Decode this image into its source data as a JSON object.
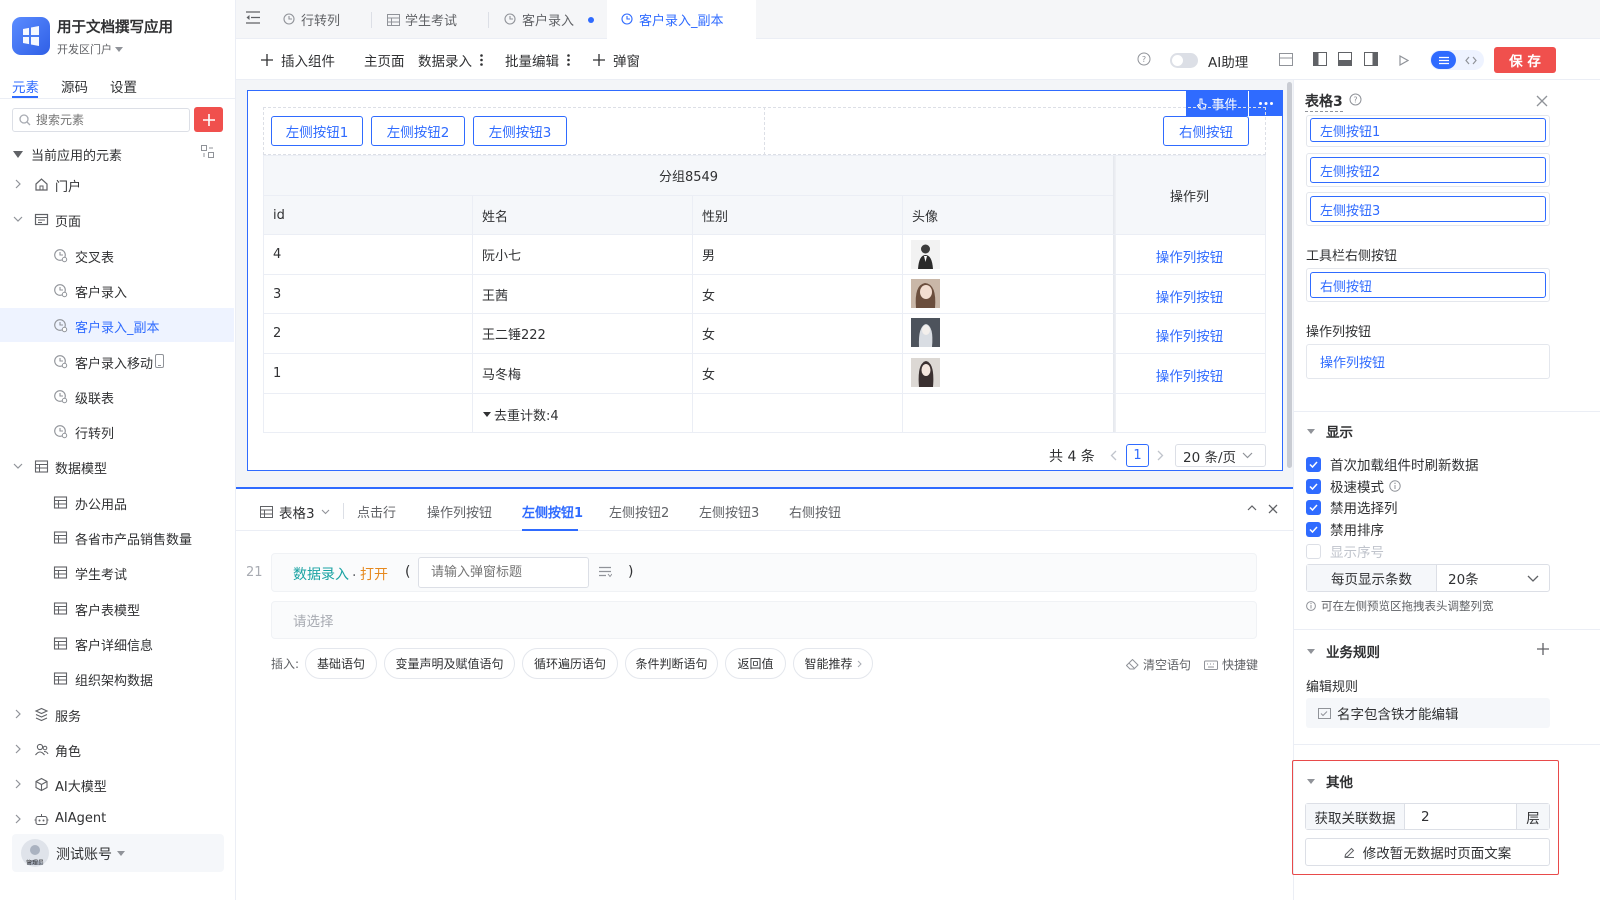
{
  "app": {
    "name": "用于文档撰写应用",
    "portal": "开发区门户"
  },
  "side_tabs": [
    "元素",
    "源码",
    "设置"
  ],
  "search": {
    "placeholder": "搜索元素"
  },
  "tree": {
    "section_label": "当前应用的元素",
    "items": [
      {
        "label": "门户",
        "icon": "home-icon",
        "level": 0,
        "collapsed": true
      },
      {
        "label": "页面",
        "icon": "page-icon",
        "level": 0,
        "collapsed": false
      },
      {
        "label": "交叉表",
        "icon": "form-page-icon",
        "level": 1
      },
      {
        "label": "客户录入",
        "icon": "form-page-icon",
        "level": 1
      },
      {
        "label": "客户录入_副本",
        "icon": "form-page-icon",
        "level": 1,
        "active": true
      },
      {
        "label": "客户录入移动",
        "icon": "form-page-icon",
        "level": 1,
        "mobile": true
      },
      {
        "label": "级联表",
        "icon": "form-page-icon",
        "level": 1
      },
      {
        "label": "行转列",
        "icon": "form-page-icon",
        "level": 1
      },
      {
        "label": "数据模型",
        "icon": "table-icon",
        "level": 0,
        "collapsed": false
      },
      {
        "label": "办公用品",
        "icon": "table-icon",
        "level": 1
      },
      {
        "label": "各省市产品销售数量",
        "icon": "table-icon",
        "level": 1
      },
      {
        "label": "学生考试",
        "icon": "table-icon",
        "level": 1
      },
      {
        "label": "客户表模型",
        "icon": "table-icon",
        "level": 1
      },
      {
        "label": "客户详细信息",
        "icon": "table-icon",
        "level": 1
      },
      {
        "label": "组织架构数据",
        "icon": "table-icon",
        "level": 1
      },
      {
        "label": "服务",
        "icon": "service-icon",
        "level": 0,
        "collapsed": true
      },
      {
        "label": "角色",
        "icon": "role-icon",
        "level": 0,
        "collapsed": true
      },
      {
        "label": "AI大模型",
        "icon": "model-icon",
        "level": 0,
        "collapsed": true
      },
      {
        "label": "AIAgent",
        "icon": "robot-icon",
        "level": 0,
        "collapsed": true
      }
    ]
  },
  "account": {
    "name": "测试账号",
    "badge": "管理员"
  },
  "tabs": [
    {
      "label": "行转列"
    },
    {
      "label": "学生考试"
    },
    {
      "label": "客户录入",
      "dirty": true
    },
    {
      "label": "客户录入_副本",
      "active": true
    }
  ],
  "toolbar": {
    "insert": "插入组件",
    "home": "主页面",
    "data_entry": "数据录入",
    "batch_edit": "批量编辑",
    "popup": "弹窗",
    "ai_assistant": "AI助理",
    "save": "保 存"
  },
  "canvas": {
    "event_label": "事件",
    "left_buttons": [
      "左侧按钮1",
      "左侧按钮2",
      "左侧按钮3"
    ],
    "right_button": "右侧按钮",
    "group_header": "分组8549",
    "op_header": "操作列",
    "columns": [
      "id",
      "姓名",
      "性别",
      "头像"
    ],
    "rows": [
      {
        "id": "4",
        "name": "阮小七",
        "gender": "男",
        "op": "操作列按钮"
      },
      {
        "id": "3",
        "name": "王茜",
        "gender": "女",
        "op": "操作列按钮"
      },
      {
        "id": "2",
        "name": "王二锤222",
        "gender": "女",
        "op": "操作列按钮"
      },
      {
        "id": "1",
        "name": "马冬梅",
        "gender": "女",
        "op": "操作列按钮"
      }
    ],
    "summary": "去重计数:4",
    "total": "共 4 条",
    "page": "1",
    "page_size": "20 条/页"
  },
  "bottom": {
    "tabs": [
      "表格3",
      "点击行",
      "操作列按钮",
      "左侧按钮1",
      "左侧按钮2",
      "左侧按钮3",
      "右侧按钮"
    ],
    "active_tab": "左侧按钮1",
    "line_no": "21",
    "code_obj": "数据录入",
    "code_method": "打开",
    "title_placeholder": "请输入弹窗标题",
    "select_placeholder": "请选择",
    "insert_label": "插入:",
    "chips": [
      "基础语句",
      "变量声明及赋值语句",
      "循环遍历语句",
      "条件判断语句",
      "返回值",
      "智能推荐"
    ],
    "clear": "清空语句",
    "shortcut": "快捷键"
  },
  "panel": {
    "title": "表格3",
    "left_buttons": [
      "左侧按钮1",
      "左侧按钮2",
      "左侧按钮3"
    ],
    "right_section": "工具栏右侧按钮",
    "right_button": "右侧按钮",
    "op_section": "操作列按钮",
    "op_button": "操作列按钮",
    "display_title": "显示",
    "checkboxes": [
      {
        "label": "首次加载组件时刷新数据",
        "checked": true
      },
      {
        "label": "极速模式",
        "checked": true,
        "info": true
      },
      {
        "label": "禁用选择列",
        "checked": true
      },
      {
        "label": "禁用排序",
        "checked": true
      },
      {
        "label": "显示序号",
        "checked": false
      }
    ],
    "page_size_label": "每页显示条数",
    "page_size_value": "20条",
    "hint": "可在左侧预览区拖拽表头调整列宽",
    "rules_title": "业务规则",
    "edit_rule_label": "编辑规则",
    "rule_name": "名字包含铁才能编辑",
    "other_title": "其他",
    "fetch_label": "获取关联数据",
    "fetch_value": "2",
    "fetch_unit": "层",
    "empty_text_btn": "修改暂无数据时页面文案",
    "highlight_color": "#e84a4a"
  },
  "colors": {
    "primary": "#2f6bff",
    "save": "#f0504d",
    "teal": "#1aa3a3",
    "orange": "#e6891e"
  }
}
